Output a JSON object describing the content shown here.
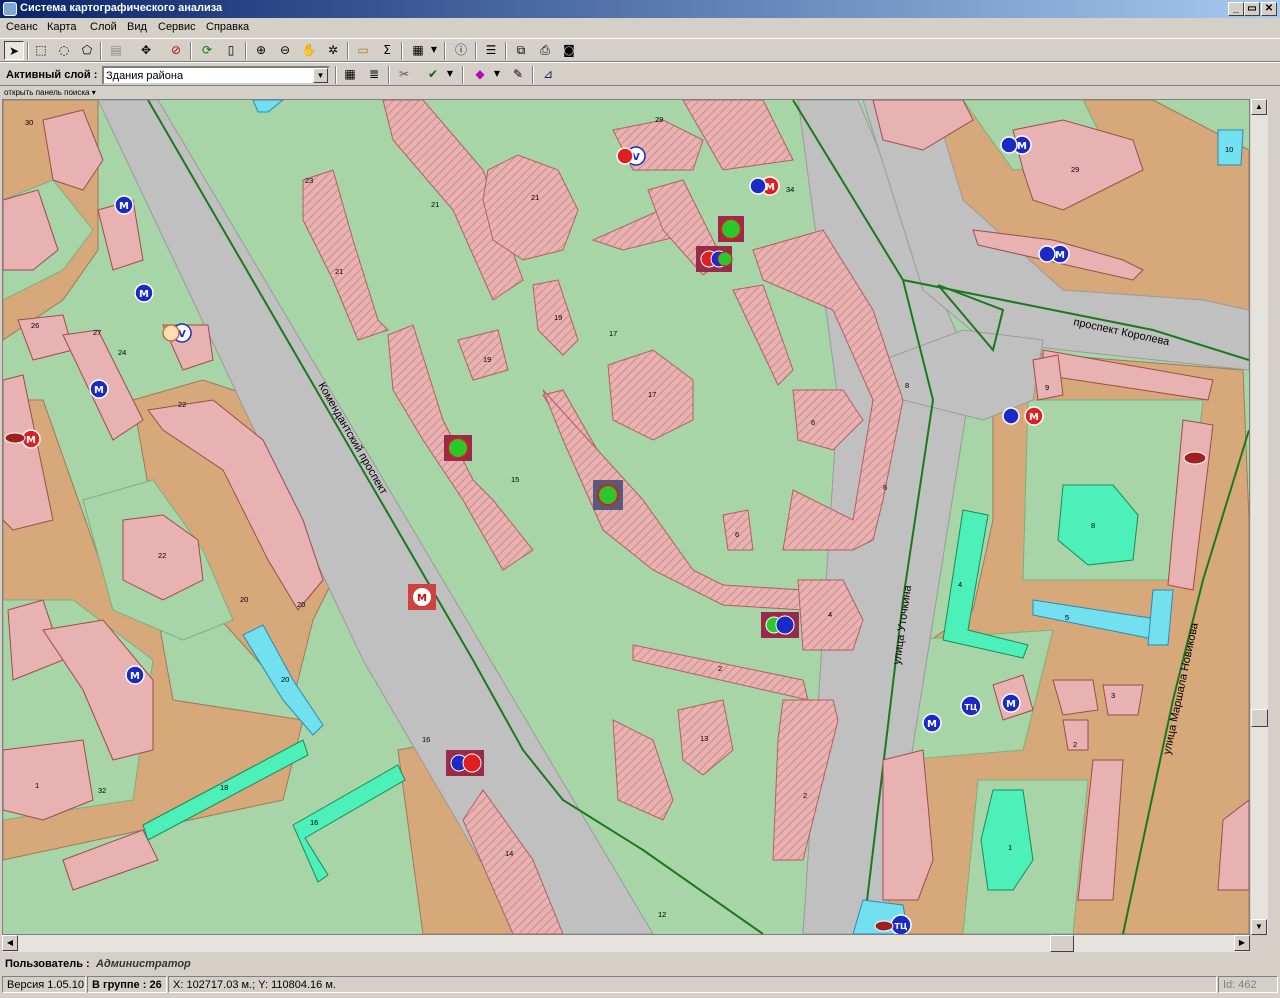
{
  "window": {
    "title": "Система картографического анализа",
    "controls": [
      "_",
      "▭",
      "✕"
    ]
  },
  "menu": [
    "Сеанс",
    "Карта",
    "Слой",
    "Вид",
    "Сервис",
    "Справка"
  ],
  "toolbar1": [
    {
      "icon": "pointer-arrow-icon",
      "glyph": "➤"
    },
    {
      "icon": "select-rect-icon",
      "glyph": "⬚"
    },
    {
      "icon": "select-circle-icon",
      "glyph": "◌"
    },
    {
      "icon": "select-polygon-icon",
      "glyph": "⬠"
    },
    {
      "icon": "layer-copy-icon",
      "glyph": "▤"
    },
    {
      "icon": "extent-icon",
      "glyph": "✥"
    },
    {
      "icon": "clear-selection-icon",
      "glyph": "⊘"
    },
    {
      "icon": "refresh-icon",
      "glyph": "⟳"
    },
    {
      "icon": "blank-page-icon",
      "glyph": "▯"
    },
    {
      "icon": "zoom-in-icon",
      "glyph": "⊕"
    },
    {
      "icon": "zoom-out-icon",
      "glyph": "⊖"
    },
    {
      "icon": "pan-hand-icon",
      "glyph": "✋"
    },
    {
      "icon": "info-pointer-icon",
      "glyph": "✲"
    },
    {
      "icon": "label-icon",
      "glyph": "▭"
    },
    {
      "icon": "sum-icon",
      "glyph": "Σ"
    },
    {
      "icon": "grid-icon",
      "glyph": "▦"
    },
    {
      "icon": "info-icon",
      "glyph": "ⓘ"
    },
    {
      "icon": "legend-icon",
      "glyph": "☰"
    },
    {
      "icon": "properties-icon",
      "glyph": "⧉"
    },
    {
      "icon": "print-icon",
      "glyph": "⎙"
    },
    {
      "icon": "camera-icon",
      "glyph": "◙"
    }
  ],
  "toolbar2": {
    "active_layer_label": "Активный слой :",
    "active_layer_value": "Здания района",
    "buttons": [
      {
        "icon": "layer-table-icon",
        "glyph": "▦"
      },
      {
        "icon": "layer-list-icon",
        "glyph": "≣"
      },
      {
        "icon": "scissors-icon",
        "glyph": "✂"
      },
      {
        "icon": "spellcheck-icon",
        "glyph": "✔"
      },
      {
        "icon": "style-shapes-icon",
        "glyph": "◆"
      },
      {
        "icon": "comment-icon",
        "glyph": "✎"
      },
      {
        "icon": "measure-icon",
        "glyph": "⊿"
      }
    ]
  },
  "search_panel_link": "открыть панель поиска ▾",
  "map": {
    "streets": [
      "Комендантский проспект",
      "проспект Королева",
      "улица Уточкина",
      "улица Маршала Новикова"
    ],
    "building_numbers": [
      "30",
      "27",
      "26",
      "24",
      "23",
      "22",
      "22",
      "21",
      "21",
      "21",
      "20",
      "20",
      "20",
      "19",
      "19",
      "18",
      "17",
      "17",
      "16",
      "16",
      "15",
      "14",
      "13",
      "12",
      "10",
      "9",
      "8",
      "8",
      "6",
      "6",
      "6",
      "5",
      "4",
      "4",
      "3",
      "2",
      "2",
      "2",
      "1",
      "1",
      "32",
      "34",
      "29",
      "29"
    ],
    "markers": [
      "М",
      "М",
      "М",
      "М",
      "М",
      "М",
      "М",
      "М",
      "М",
      "М",
      "М",
      "М",
      "ТЦ",
      "ТЦ",
      "V",
      "V"
    ]
  },
  "user": {
    "label": "Пользователь :",
    "name": "Администратор"
  },
  "status": {
    "version": "Версия 1.05.10",
    "group": "В группе : 26",
    "coords": "X: 102717.03 м.; Y: 110804.16 м.",
    "id": "Id: 462"
  },
  "colors": {
    "park": "#a8d5a8",
    "road": "#c0c0c0",
    "district": "#d7a87a",
    "building": "#e8b2b2",
    "building_hatch": "#d08a8a",
    "edu": "#4cf0b8",
    "cyan": "#73e0f0",
    "marker_blue": "#1a2ac8",
    "marker_red": "#e02020"
  }
}
